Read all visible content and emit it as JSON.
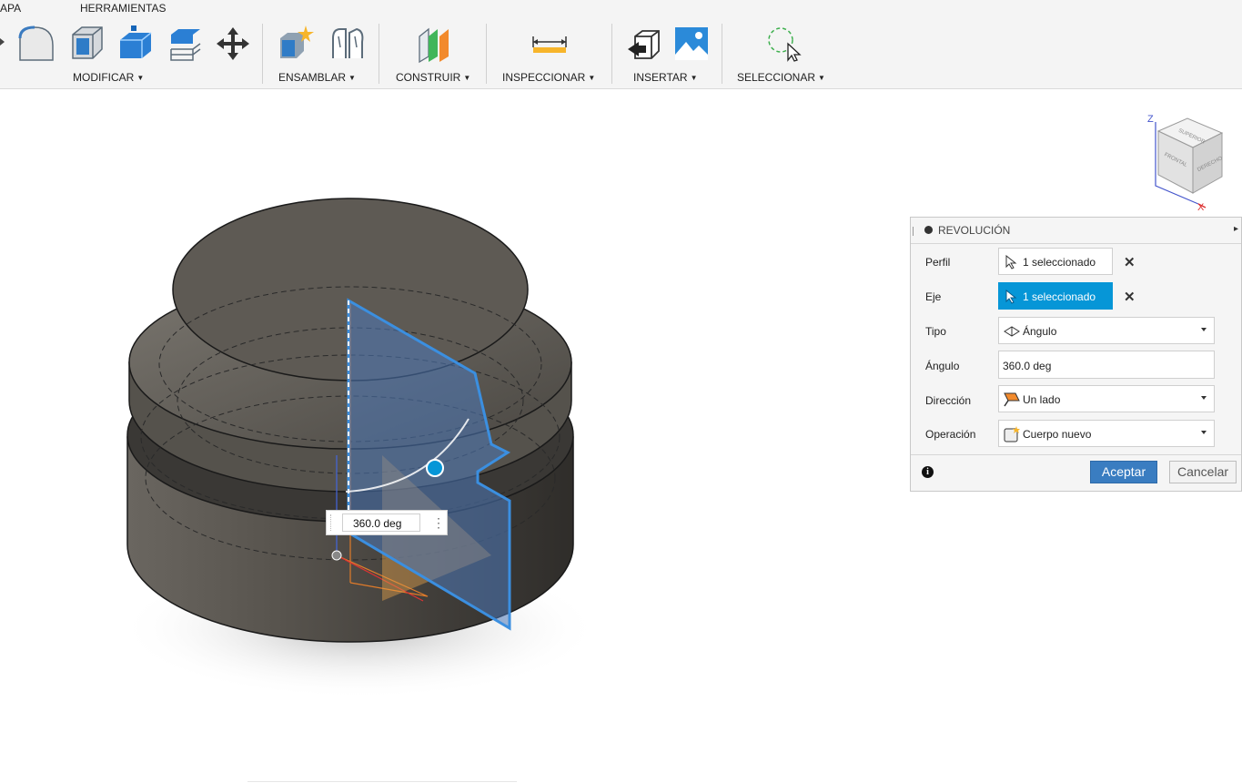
{
  "toolbar": {
    "tabs": [
      "APA",
      "HERRAMIENTAS"
    ],
    "groups": {
      "modificar": "MODIFICAR",
      "ensamblar": "ENSAMBLAR",
      "construir": "CONSTRUIR",
      "inspeccionar": "INSPECCIONAR",
      "insertar": "INSERTAR",
      "seleccionar": "SELECCIONAR"
    }
  },
  "viewcube": {
    "faces": [
      "SUPERIOR",
      "FRONTAL",
      "DERECHO"
    ],
    "axes": [
      "Z",
      "X"
    ]
  },
  "dialog": {
    "title": "REVOLUCIÓN",
    "perfil": {
      "label": "Perfil",
      "value": "1 seleccionado"
    },
    "eje": {
      "label": "Eje",
      "value": "1 seleccionado"
    },
    "tipo": {
      "label": "Tipo",
      "value": "Ángulo"
    },
    "angulo": {
      "label": "Ángulo",
      "value": "360.0 deg"
    },
    "direccion": {
      "label": "Dirección",
      "value": "Un lado"
    },
    "operacion": {
      "label": "Operación",
      "value": "Cuerpo nuevo"
    },
    "accept_label": "Aceptar",
    "cancel_label": "Cancelar"
  },
  "canvas": {
    "angle_input": "360.0 deg"
  },
  "colors": {
    "accent": "#0696d7",
    "profile": "#3b8fe0",
    "accept": "#3a7dc1",
    "body": "#4d4a45"
  }
}
